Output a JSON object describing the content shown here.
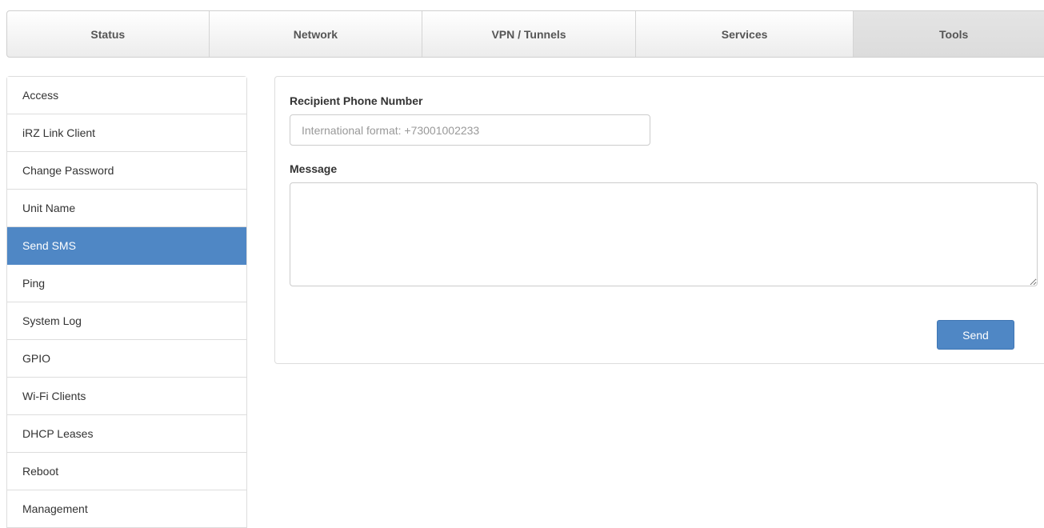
{
  "topnav": {
    "tabs": [
      {
        "label": "Status"
      },
      {
        "label": "Network"
      },
      {
        "label": "VPN / Tunnels"
      },
      {
        "label": "Services"
      },
      {
        "label": "Tools"
      }
    ],
    "active": "Tools"
  },
  "sidebar": {
    "items": [
      {
        "label": "Access"
      },
      {
        "label": "iRZ Link Client"
      },
      {
        "label": "Change Password"
      },
      {
        "label": "Unit Name"
      },
      {
        "label": "Send SMS"
      },
      {
        "label": "Ping"
      },
      {
        "label": "System Log"
      },
      {
        "label": "GPIO"
      },
      {
        "label": "Wi-Fi Clients"
      },
      {
        "label": "DHCP Leases"
      },
      {
        "label": "Reboot"
      },
      {
        "label": "Management"
      }
    ],
    "active": "Send SMS"
  },
  "form": {
    "phone_label": "Recipient Phone Number",
    "phone_placeholder": "International format: +73001002233",
    "phone_value": "",
    "message_label": "Message",
    "message_value": "",
    "send_label": "Send"
  },
  "colors": {
    "accent": "#4f87c5",
    "border": "#dddddd"
  }
}
